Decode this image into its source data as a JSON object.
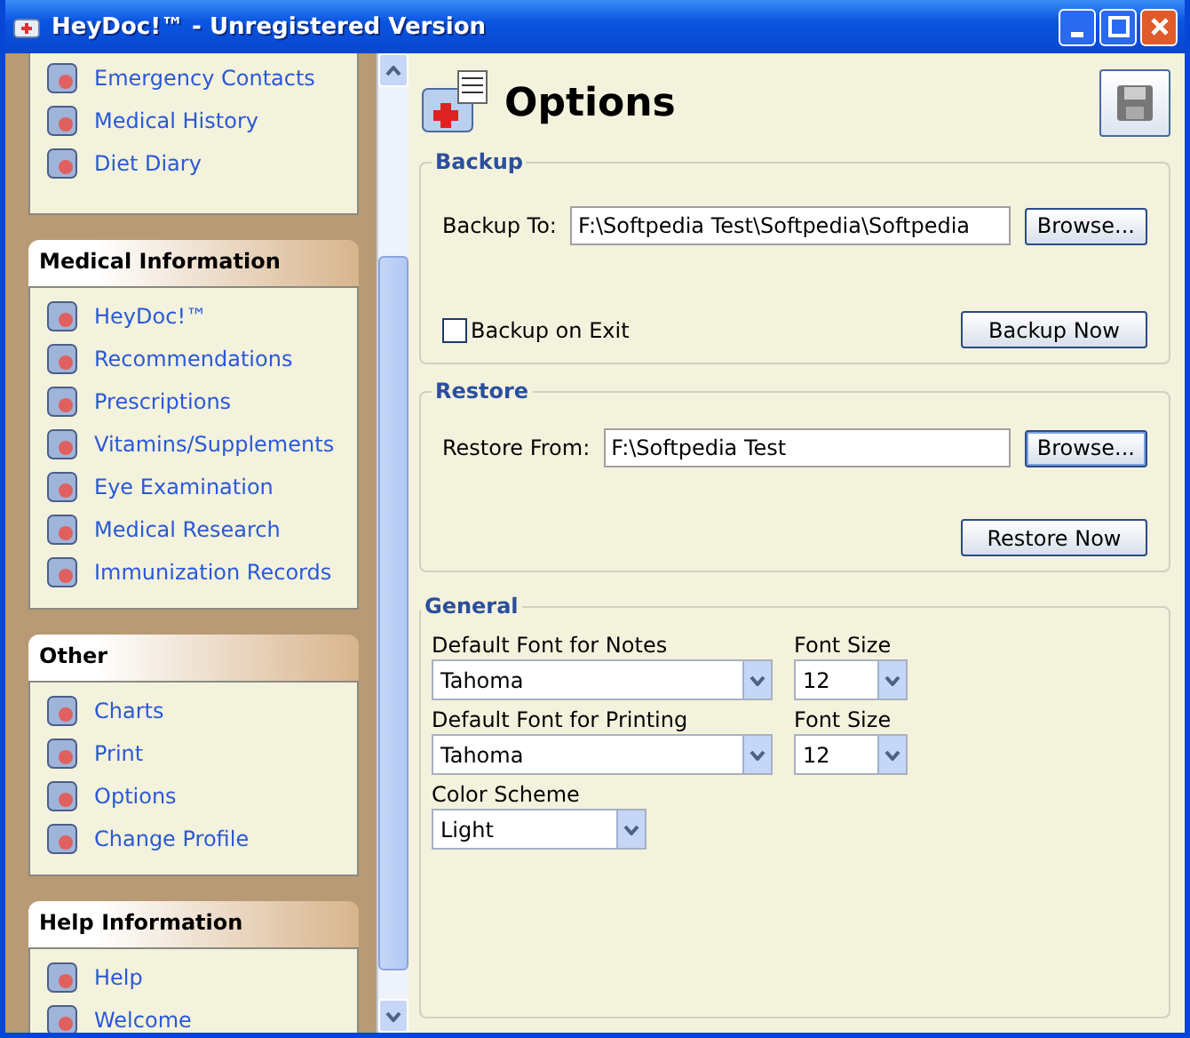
{
  "window": {
    "title": "HeyDoc!™ - Unregistered Version"
  },
  "sidebar": {
    "groups": [
      {
        "items": [
          {
            "label": "Emergency Contacts"
          },
          {
            "label": "Medical History"
          },
          {
            "label": "Diet Diary"
          }
        ]
      },
      {
        "title": "Medical Information",
        "items": [
          {
            "label": "HeyDoc!™"
          },
          {
            "label": "Recommendations"
          },
          {
            "label": "Prescriptions"
          },
          {
            "label": "Vitamins/Supplements"
          },
          {
            "label": "Eye Examination"
          },
          {
            "label": "Medical Research"
          },
          {
            "label": "Immunization Records"
          }
        ]
      },
      {
        "title": "Other",
        "items": [
          {
            "label": "Charts"
          },
          {
            "label": "Print"
          },
          {
            "label": "Options"
          },
          {
            "label": "Change Profile"
          }
        ]
      },
      {
        "title": "Help Information",
        "items": [
          {
            "label": "Help"
          },
          {
            "label": "Welcome"
          }
        ]
      }
    ]
  },
  "page": {
    "title": "Options"
  },
  "backup": {
    "legend": "Backup",
    "label": "Backup To:",
    "value": "F:\\Softpedia Test\\Softpedia\\Softpedia",
    "browse": "Browse...",
    "checkbox": {
      "label": "Backup on Exit",
      "checked": false
    },
    "action": "Backup Now"
  },
  "restore": {
    "legend": "Restore",
    "label": "Restore From:",
    "value": "F:\\Softpedia Test",
    "browse": "Browse...",
    "action": "Restore Now"
  },
  "general": {
    "legend": "General",
    "rows": [
      {
        "font_label": "Default Font for Notes",
        "font": "Tahoma",
        "size_label": "Font Size",
        "size": "12"
      },
      {
        "font_label": "Default Font for Printing",
        "font": "Tahoma",
        "size_label": "Font Size",
        "size": "12"
      }
    ],
    "scheme_label": "Color Scheme",
    "scheme": "Light"
  }
}
